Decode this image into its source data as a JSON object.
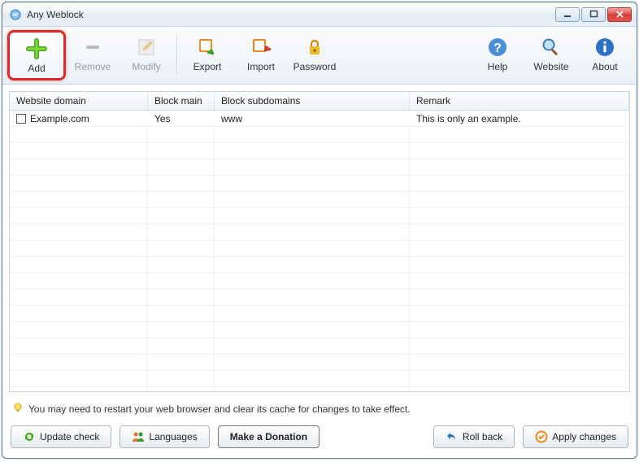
{
  "window": {
    "title": "Any Weblock"
  },
  "toolbar": {
    "add": "Add",
    "remove": "Remove",
    "modify": "Modify",
    "export": "Export",
    "import": "Import",
    "password": "Password",
    "help": "Help",
    "website": "Website",
    "about": "About"
  },
  "columns": {
    "domain": "Website domain",
    "block_main": "Block main",
    "block_sub": "Block subdomains",
    "remark": "Remark"
  },
  "rows": [
    {
      "domain": "Example.com",
      "block_main": "Yes",
      "block_sub": "www",
      "remark": "This is only an example."
    }
  ],
  "hint": "You may need to restart your web browser and clear its cache for changes to take effect.",
  "bottom": {
    "update": "Update check",
    "languages": "Languages",
    "donate": "Make a Donation",
    "rollback": "Roll back",
    "apply": "Apply changes"
  },
  "colors": {
    "accent_green": "#4aa61a",
    "accent_orange": "#f08a1d",
    "accent_blue": "#2e72c6",
    "highlight_red": "#d92b2b"
  }
}
